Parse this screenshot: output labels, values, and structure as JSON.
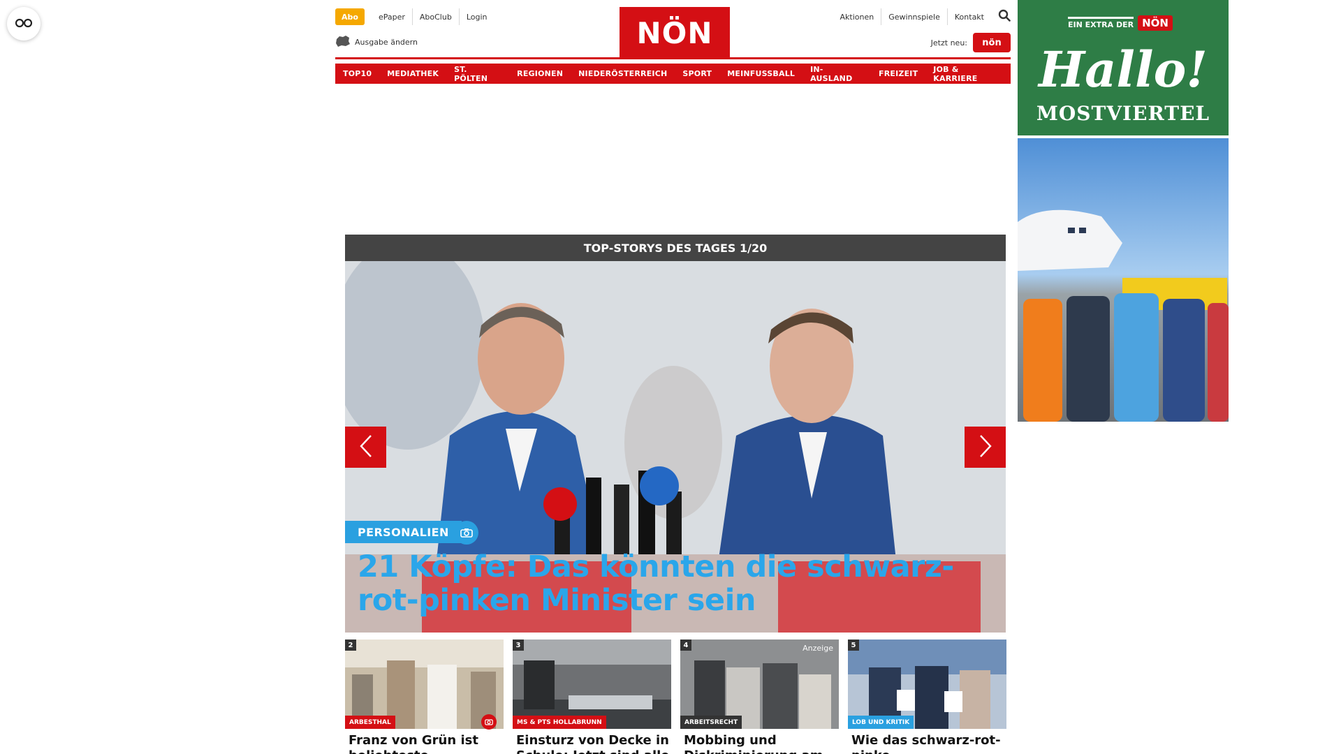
{
  "header": {
    "abo_label": "Abo",
    "top_links": [
      "ePaper",
      "AboClub",
      "Login"
    ],
    "ausgabe_label": "Ausgabe ändern",
    "logo_text": "NÖN",
    "right_links": [
      "Aktionen",
      "Gewinnspiele",
      "Kontakt"
    ],
    "jetzt_neu_label": "Jetzt neu:",
    "jetzt_badge": "nön",
    "accent_color": "#d40f14"
  },
  "nav": {
    "items": [
      "TOP10",
      "MEDIATHEK",
      "ST. PÖLTEN",
      "REGIONEN",
      "NIEDERÖSTERREICH",
      "SPORT",
      "MEINFUSSBALL",
      "IN-AUSLAND",
      "FREIZEIT",
      "JOB & KARRIERE"
    ]
  },
  "side_ad": {
    "extra_label": "EIN EXTRA DER",
    "badge": "NÖN",
    "headline": "Hallo!",
    "region": "MOSTVIERTEL"
  },
  "top_stories": {
    "bar_title": "TOP-STORYS DES TAGES 1/20",
    "hero": {
      "category": "PERSONALIEN",
      "title": "21 Köpfe: Das könnten die schwarz-rot-pinken Minister sein",
      "category_color": "#2aa0e0"
    },
    "cards": [
      {
        "num": "2",
        "category": "ARBESTHAL",
        "title": "Franz von Grün ist beliebteste",
        "has_camera": true
      },
      {
        "num": "3",
        "category": "MS & PTS HOLLABRUNN",
        "title": "Einsturz von Decke in Schule: Jetzt sind alle",
        "has_camera": false
      },
      {
        "num": "4",
        "category": "ARBEITSRECHT",
        "title": "Mobbing und Diskriminierung am",
        "anzeige": "Anzeige",
        "has_camera": false
      },
      {
        "num": "5",
        "category": "LOB UND KRITIK",
        "title": "Wie das schwarz-rot-pinke",
        "has_camera": false
      }
    ]
  }
}
